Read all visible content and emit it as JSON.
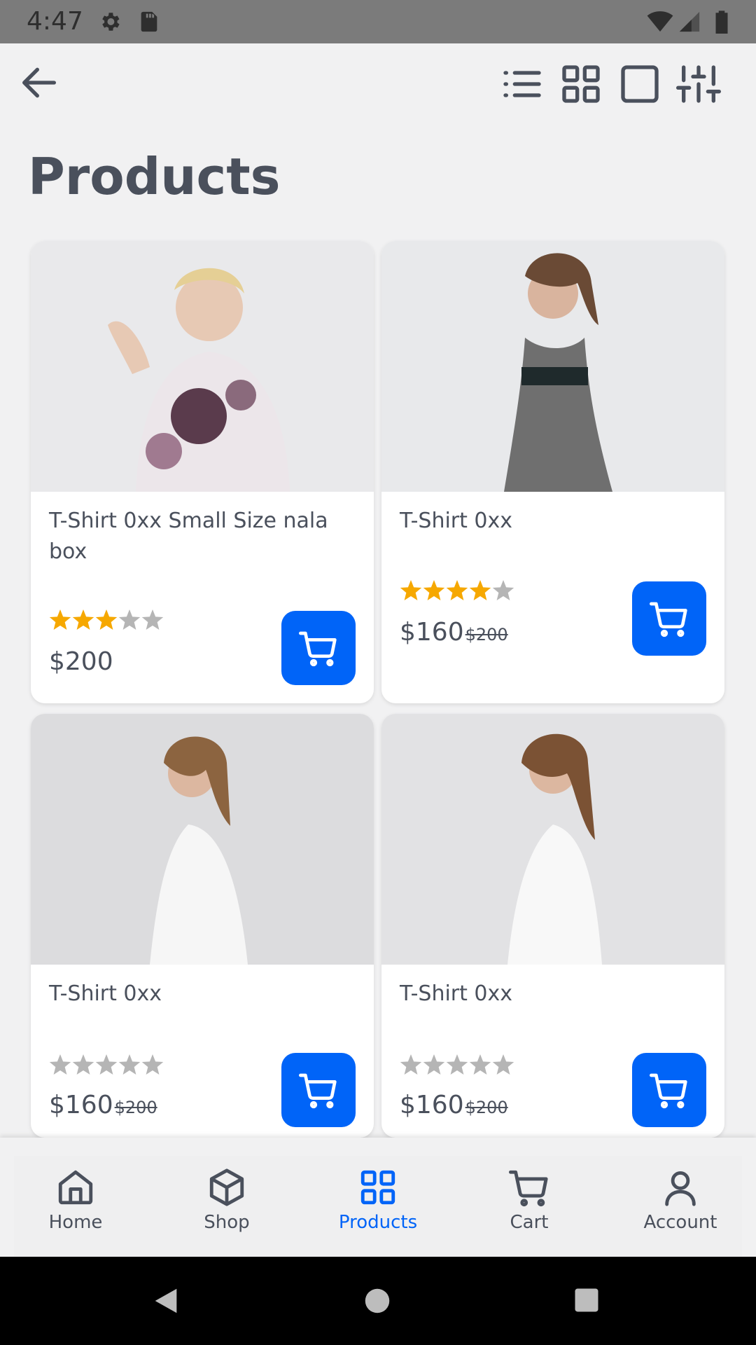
{
  "status_bar": {
    "time": "4:47"
  },
  "header": {
    "title": "Products"
  },
  "products": [
    {
      "name": "T-Shirt 0xx Small Size nala box",
      "rating": 3,
      "max_rating": 5,
      "price": "$200",
      "old_price": ""
    },
    {
      "name": "T-Shirt 0xx",
      "rating": 4,
      "max_rating": 5,
      "price": "$160",
      "old_price": "$200"
    },
    {
      "name": "T-Shirt 0xx",
      "rating": 0,
      "max_rating": 5,
      "price": "$160",
      "old_price": "$200"
    },
    {
      "name": "T-Shirt 0xx",
      "rating": 0,
      "max_rating": 5,
      "price": "$160",
      "old_price": "$200"
    }
  ],
  "bottom_nav": {
    "items": [
      {
        "label": "Home",
        "icon": "home-icon"
      },
      {
        "label": "Shop",
        "icon": "box-icon"
      },
      {
        "label": "Products",
        "icon": "grid-icon",
        "active": true
      },
      {
        "label": "Cart",
        "icon": "cart-icon"
      },
      {
        "label": "Account",
        "icon": "user-icon"
      }
    ]
  },
  "colors": {
    "accent": "#0064f8",
    "star_filled": "#f6a800",
    "star_empty": "#b5b5b5",
    "text": "#4a505c"
  }
}
